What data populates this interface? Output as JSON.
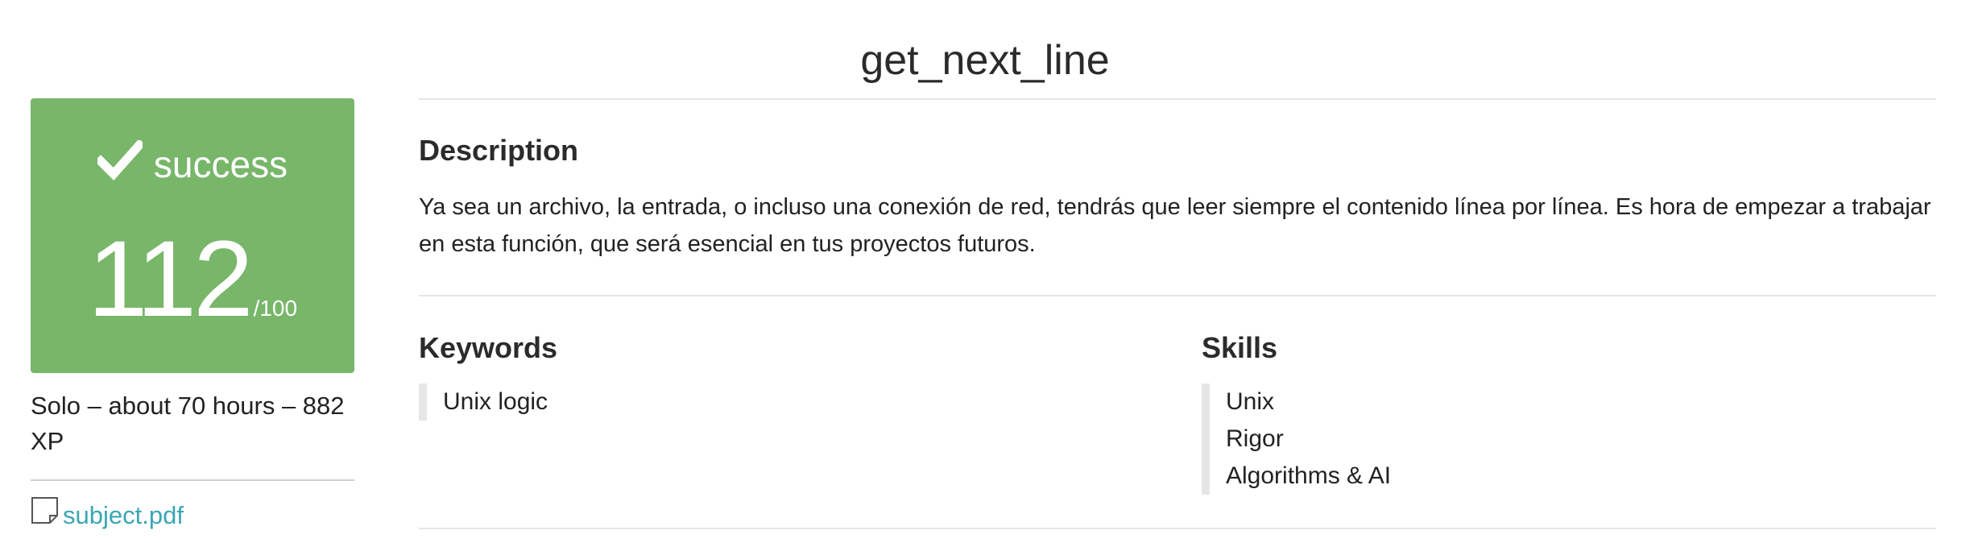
{
  "project": {
    "title": "get_next_line"
  },
  "score_card": {
    "status": "success",
    "score": "112",
    "max": "/100",
    "accent_color": "#78b66a",
    "icon": "checkmark-icon"
  },
  "meta": {
    "text": "Solo – about 70 hours – 882 XP"
  },
  "attachment": {
    "label": "subject.pdf",
    "icon": "file-icon"
  },
  "description": {
    "title": "Description",
    "text": "Ya sea un archivo, la entrada, o incluso una conexión de red, tendrás que leer siempre el contenido línea por línea. Es hora de empezar a trabajar en esta función, que será esencial en tus proyectos futuros."
  },
  "keywords": {
    "title": "Keywords",
    "items": [
      "Unix logic"
    ]
  },
  "skills": {
    "title": "Skills",
    "items": [
      "Unix",
      "Rigor",
      "Algorithms & AI"
    ]
  }
}
